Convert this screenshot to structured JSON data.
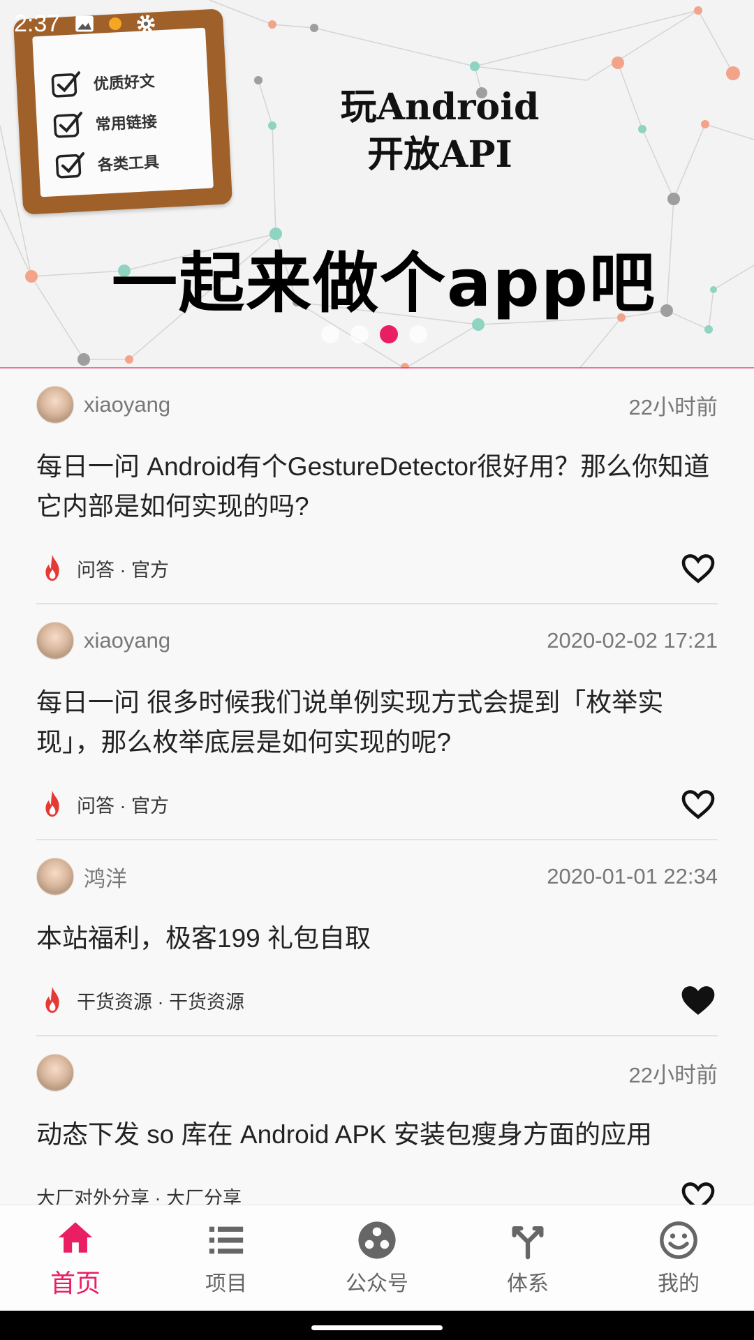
{
  "status_bar": {
    "time": "2:37",
    "icons": [
      "image-icon",
      "notification-dot",
      "settings-icon"
    ]
  },
  "banner": {
    "checklist": [
      "优质好文",
      "常用链接",
      "各类工具"
    ],
    "title_line1": "玩Android",
    "title_line2": "开放API",
    "slogan": "一起来做个app吧",
    "page_count": 4,
    "active_page": 3
  },
  "articles": [
    {
      "author": "xiaoyang",
      "time": "22小时前",
      "title": "每日一问 Android有个GestureDetector很好用？那么你知道它内部是如何实现的吗?",
      "tags": "问答 · 官方",
      "hot": true,
      "liked": false
    },
    {
      "author": "xiaoyang",
      "time": "2020-02-02 17:21",
      "title": "每日一问 很多时候我们说单例实现方式会提到「枚举实现」，那么枚举底层是如何实现的呢?",
      "tags": "问答 · 官方",
      "hot": true,
      "liked": false
    },
    {
      "author": "鸿洋",
      "time": "2020-01-01 22:34",
      "title": "本站福利，极客199 礼包自取",
      "tags": "干货资源 · 干货资源",
      "hot": true,
      "liked": true
    },
    {
      "author": "",
      "time": "22小时前",
      "title": "动态下发 so 库在 Android APK 安装包瘦身方面的应用",
      "tags": "大厂对外分享 · 大厂分享",
      "hot": false,
      "liked": false
    }
  ],
  "bottom_nav": [
    {
      "label": "首页",
      "icon": "home-icon",
      "active": true
    },
    {
      "label": "项目",
      "icon": "list-icon",
      "active": false
    },
    {
      "label": "公众号",
      "icon": "account-icon",
      "active": false
    },
    {
      "label": "体系",
      "icon": "fork-icon",
      "active": false
    },
    {
      "label": "我的",
      "icon": "smiley-icon",
      "active": false
    }
  ],
  "colors": {
    "accent": "#e91e63",
    "fire": "#e53935",
    "notepad_frame": "#a0602a"
  }
}
